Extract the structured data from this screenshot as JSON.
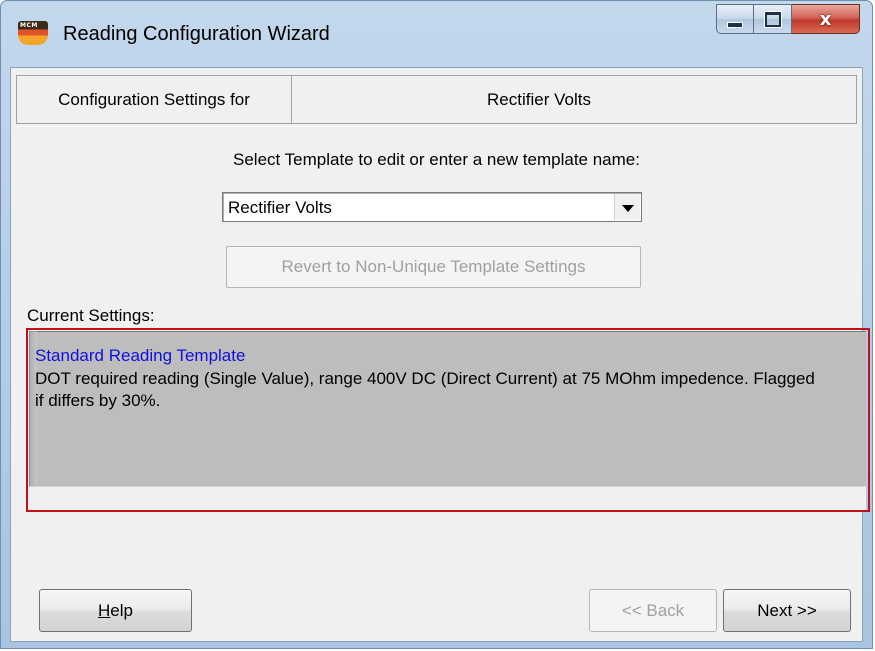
{
  "window": {
    "title": "Reading Configuration Wizard",
    "app_icon_text": "MCM",
    "close_glyph": "x"
  },
  "config": {
    "label": "Configuration Settings for",
    "value": "Rectifier Volts"
  },
  "template": {
    "prompt": "Select Template to edit or enter a new template name:",
    "selected": "Rectifier Volts",
    "revert_label": "Revert to Non-Unique Template Settings"
  },
  "current": {
    "label": "Current Settings:",
    "title": "Standard Reading Template",
    "description": "DOT required reading (Single Value), range 400V DC (Direct Current) at 75 MOhm impedence. Flagged if differs by 30%."
  },
  "buttons": {
    "help_prefix": "H",
    "help_rest": "elp",
    "back": "<< Back",
    "next": "Next >>"
  },
  "colors": {
    "highlight_outline": "#c0101a",
    "template_title": "#1010e0",
    "settings_bg": "#bdbdbd"
  }
}
